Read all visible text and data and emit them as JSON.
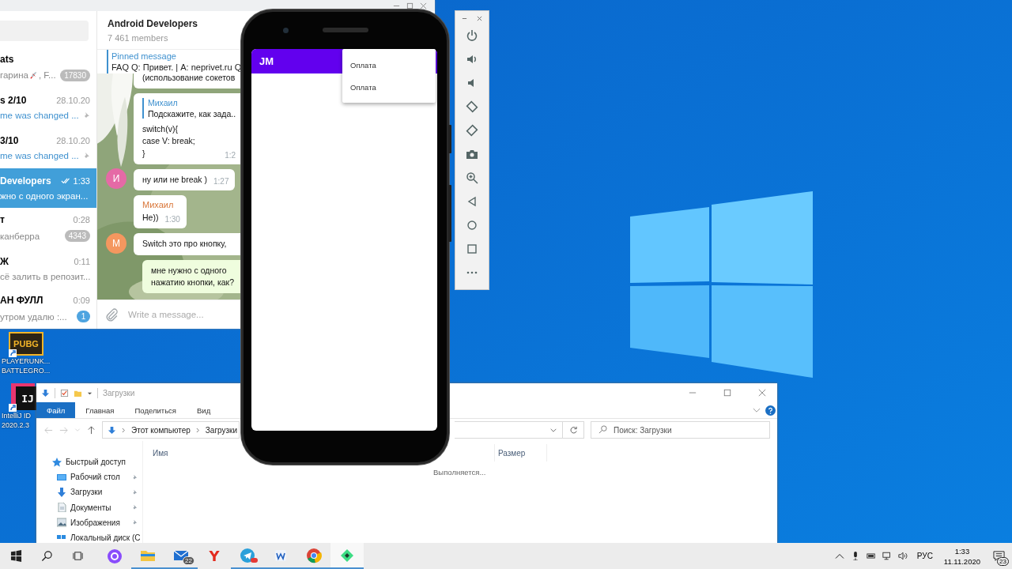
{
  "telegram": {
    "chats": [
      {
        "title": "ats",
        "preview": "гарина",
        "preview_rest": ", F...",
        "badge": "17830",
        "badge_muted": true,
        "preview_accent": false,
        "pinned": false,
        "read": false,
        "selected": false
      },
      {
        "title": "s 2/10",
        "time": "28.10.20",
        "preview": "me was changed ...",
        "preview_accent": true,
        "pinned": true,
        "read": false,
        "selected": false
      },
      {
        "title": "3/10",
        "time": "28.10.20",
        "preview": "me was changed ...",
        "preview_accent": true,
        "pinned": true,
        "read": false,
        "selected": false
      },
      {
        "title": "Developers",
        "time": "1:33",
        "preview": "жно с одного экран...",
        "preview_accent": false,
        "pinned": false,
        "read": true,
        "selected": true
      },
      {
        "title": "т",
        "time": "0:28",
        "preview": "канберра",
        "badge": "4343",
        "badge_muted": true,
        "preview_accent": false,
        "pinned": false,
        "read": false,
        "selected": false
      },
      {
        "title": "Ж",
        "time": "0:11",
        "preview": "сё залить в репозит...",
        "preview_accent": false,
        "pinned": false,
        "read": false,
        "selected": false
      },
      {
        "title": "АН ФУЛЛ",
        "time": "0:09",
        "preview": "утром удалю :...",
        "badge": "1",
        "badge_muted": false,
        "preview_accent": false,
        "pinned": false,
        "read": false,
        "selected": false
      }
    ],
    "chat": {
      "title": "Android Developers",
      "members": "7 461 members",
      "pinned_label": "Pinned message",
      "pinned_text": "FAQ Q: Привет. | A: neprivet.ru Q",
      "messages": [
        {
          "kind": "in",
          "clipped": true,
          "lines": [
            "(использование сокетов"
          ]
        },
        {
          "kind": "in",
          "clipped": true,
          "reply_author": "Михаил",
          "reply_text": "Подскажите, как зада..",
          "lines": [
            "switch(v){",
            "case V: break;",
            "}"
          ],
          "time": "1:2"
        },
        {
          "kind": "in",
          "clipped": false,
          "avatar": {
            "letter": "И",
            "color": "#e56aa6"
          },
          "lines": [
            "ну или не break )"
          ],
          "time": "1:27"
        },
        {
          "kind": "in",
          "clipped": false,
          "author": "Михаил",
          "lines": [
            "Не))"
          ],
          "time": "1:30"
        },
        {
          "kind": "in",
          "clipped": true,
          "avatar": {
            "letter": "М",
            "color": "#f4975f"
          },
          "lines": [
            "Switch это про кнопку,"
          ]
        },
        {
          "kind": "out",
          "clipped": true,
          "lines": [
            "мне нужно с одного",
            "нажатию кнопки, как?"
          ]
        }
      ],
      "input_placeholder": "Write a message..."
    }
  },
  "emulator": {
    "app_title": "JM",
    "menu": [
      "Оплата",
      "Оплата"
    ]
  },
  "desktop_icons": [
    {
      "kind": "pubg",
      "logo": "PUBG",
      "label": [
        "PLAYERUNK...",
        "BATTLEGRO..."
      ]
    },
    {
      "kind": "intellij",
      "logo": "IJ",
      "label": [
        "IntelliJ ID",
        "2020.2.3"
      ]
    }
  ],
  "explorer": {
    "title": "Загрузки",
    "ribbon_tabs": [
      {
        "label": "Файл",
        "selected": true
      },
      {
        "label": "Главная",
        "selected": false
      },
      {
        "label": "Поделиться",
        "selected": false
      },
      {
        "label": "Вид",
        "selected": false
      }
    ],
    "path": [
      "Этот компьютер",
      "Загрузки"
    ],
    "search_placeholder": "Поиск: Загрузки",
    "nav": [
      {
        "label": "Быстрый доступ",
        "kind": "quick",
        "pinned": false
      },
      {
        "label": "Рабочий стол",
        "kind": "desktop",
        "pinned": true
      },
      {
        "label": "Загрузки",
        "kind": "downloads",
        "pinned": true
      },
      {
        "label": "Документы",
        "kind": "documents",
        "pinned": true
      },
      {
        "label": "Изображения",
        "kind": "pictures",
        "pinned": true
      },
      {
        "label": "Локальный диск (С",
        "kind": "drive",
        "pinned": false
      }
    ],
    "columns": [
      "Имя",
      "Размер"
    ],
    "status": "Выполняется..."
  },
  "taskbar": {
    "apps": [
      {
        "kind": "alice",
        "running": false,
        "selected": false
      },
      {
        "kind": "explorer",
        "running": true,
        "selected": false
      },
      {
        "kind": "mail",
        "running": true,
        "selected": false,
        "badge": "22"
      },
      {
        "kind": "yandex",
        "running": false,
        "selected": false,
        "glyph": "Y"
      },
      {
        "kind": "telegram",
        "running": true,
        "selected": false,
        "alert": true
      },
      {
        "kind": "word",
        "running": true,
        "selected": false
      },
      {
        "kind": "chrome",
        "running": true,
        "selected": false
      },
      {
        "kind": "studio",
        "running": true,
        "selected": true
      }
    ],
    "language": "РУС",
    "time": "1:33",
    "date": "11.11.2020",
    "notifications": "23"
  }
}
